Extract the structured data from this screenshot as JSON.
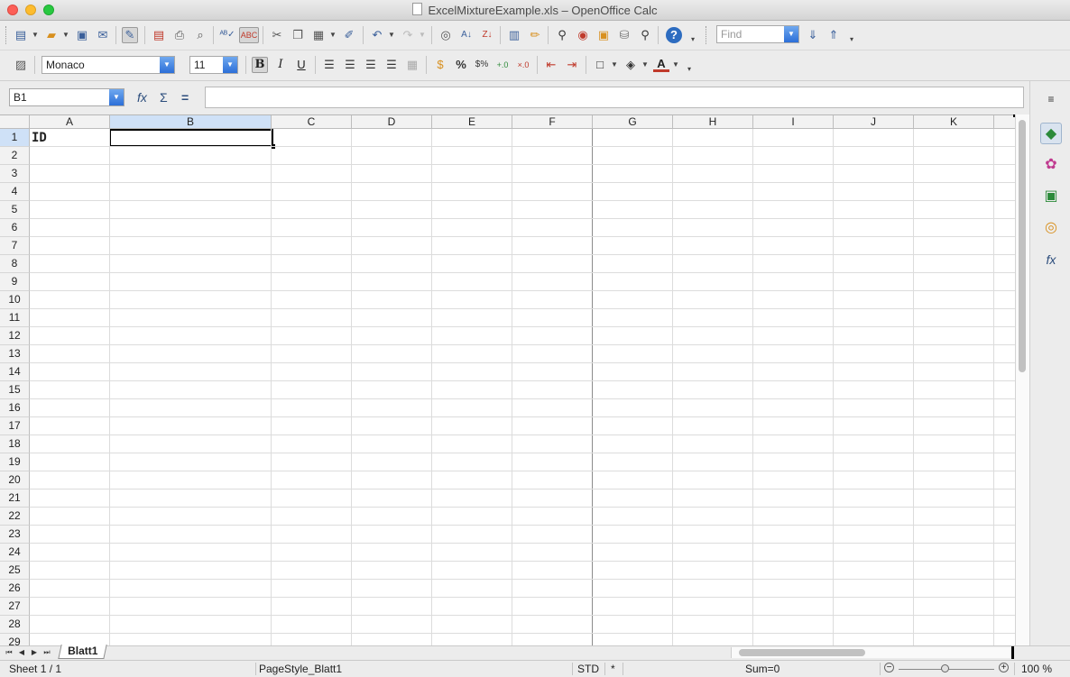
{
  "window": {
    "title": "ExcelMixtureExample.xls – OpenOffice Calc"
  },
  "find": {
    "placeholder": "Find"
  },
  "font": {
    "name": "Monaco",
    "size": "11"
  },
  "name_box": {
    "value": "B1"
  },
  "columns": [
    "A",
    "B",
    "C",
    "D",
    "E",
    "F",
    "G",
    "H",
    "I",
    "J",
    "K"
  ],
  "selected_column": "B",
  "rows": [
    "1",
    "2",
    "3",
    "4",
    "5",
    "6",
    "7",
    "8",
    "9",
    "10",
    "11",
    "12",
    "13",
    "14",
    "15",
    "16",
    "17",
    "18",
    "19",
    "20",
    "21",
    "22",
    "23",
    "24",
    "25",
    "26",
    "27",
    "28",
    "29"
  ],
  "selected_row": "1",
  "cells": {
    "A1": "ID",
    "B1": ""
  },
  "tabs": [
    {
      "label": "Blatt1",
      "active": true
    }
  ],
  "status": {
    "sheet": "Sheet 1 / 1",
    "page_style": "PageStyle_Blatt1",
    "mode": "STD",
    "modified": "*",
    "sum": "Sum=0",
    "zoom": "100 %"
  },
  "colors": {
    "selection_header": "#cfe1f7",
    "accent": "#2c6fd8"
  }
}
